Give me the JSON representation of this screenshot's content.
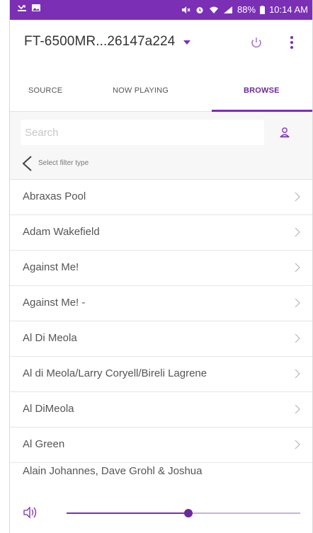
{
  "status_bar": {
    "battery": "88%",
    "time": "10:14 AM"
  },
  "header": {
    "device_name": "FT-6500MR...26147a224"
  },
  "tabs": [
    {
      "label": "SOURCE",
      "active": false
    },
    {
      "label": "NOW PLAYING",
      "active": false
    },
    {
      "label": "BROWSE",
      "active": true
    }
  ],
  "search": {
    "placeholder": "Search",
    "value": ""
  },
  "filter": {
    "label": "Select filter type"
  },
  "artists": [
    {
      "name": "Abraxas Pool"
    },
    {
      "name": "Adam Wakefield"
    },
    {
      "name": "Against Me!"
    },
    {
      "name": "Against Me! -"
    },
    {
      "name": "Al Di Meola"
    },
    {
      "name": "Al di Meola/Larry Coryell/Bireli Lagrene"
    },
    {
      "name": "Al DiMeola"
    },
    {
      "name": "Al Green"
    },
    {
      "name": "Alain Johannes, Dave Grohl & Joshua"
    }
  ],
  "volume": {
    "level": 0.52
  },
  "colors": {
    "accent": "#7b2fb5",
    "status_bar": "#7b2fb5",
    "text": "#555555"
  }
}
